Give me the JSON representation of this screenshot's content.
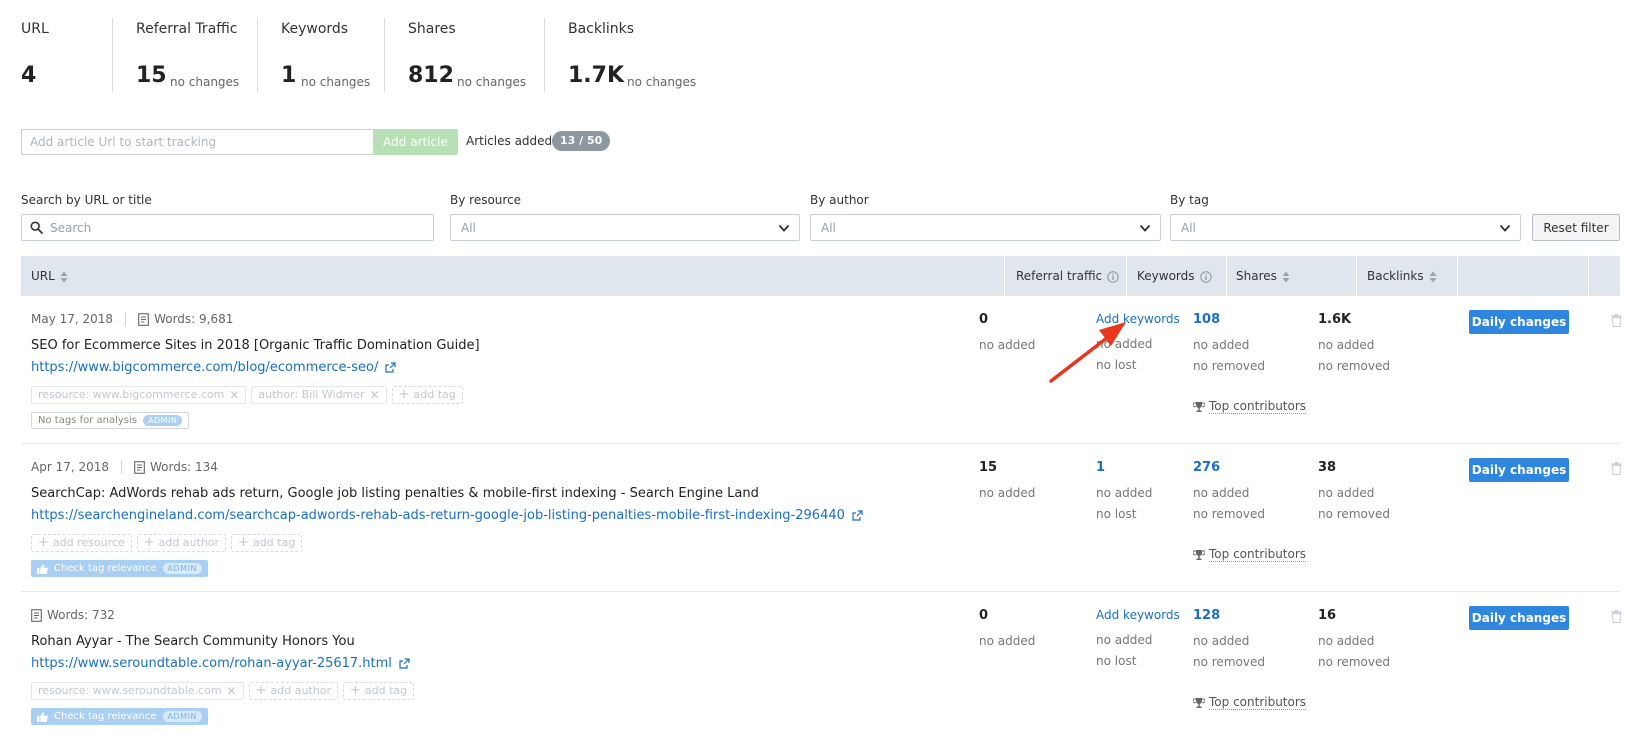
{
  "summary": [
    {
      "label": "URL",
      "value": "4",
      "change": ""
    },
    {
      "label": "Referral Traffic",
      "value": "15",
      "change": "no changes"
    },
    {
      "label": "Keywords",
      "value": "1",
      "change": "no changes"
    },
    {
      "label": "Shares",
      "value": "812",
      "change": "no changes"
    },
    {
      "label": "Backlinks",
      "value": "1.7K",
      "change": "no changes"
    }
  ],
  "add_article": {
    "placeholder": "Add article Url to start tracking",
    "button": "Add article",
    "added_label": "Articles added:",
    "added_count": "13 / 50"
  },
  "filters": {
    "search_label": "Search by URL or title",
    "search_placeholder": "Search",
    "resource_label": "By resource",
    "resource_value": "All",
    "author_label": "By author",
    "author_value": "All",
    "tag_label": "By tag",
    "tag_value": "All",
    "reset": "Reset filter"
  },
  "table": {
    "headers": {
      "url": "URL",
      "referral": "Referral traffic",
      "keywords": "Keywords",
      "shares": "Shares",
      "backlinks": "Backlinks"
    },
    "rows": [
      {
        "date": "May 17, 2018",
        "words": "Words: 9,681",
        "title": "SEO for Ecommerce Sites in 2018 [Organic Traffic Domination Guide]",
        "url": "https://www.bigcommerce.com/blog/ecommerce-seo/",
        "tag_resource": "resource: www.bigcommerce.com",
        "tag_author": "author: Bill Widmer",
        "tag_add": "add tag",
        "analysis": "No tags for analysis",
        "admin": "ADMIN",
        "referral": "0",
        "referral_sub": "no added",
        "keywords": "Add keywords",
        "keywords_sub1": "no added",
        "keywords_sub2": "no lost",
        "shares": "108",
        "shares_sub1": "no added",
        "shares_sub2": "no removed",
        "contributors": "Top contributors",
        "backlinks": "1.6K",
        "backlinks_sub1": "no added",
        "backlinks_sub2": "no removed",
        "daily": "Daily changes"
      },
      {
        "date": "Apr 17, 2018",
        "words": "Words: 134",
        "title": "SearchCap: AdWords rehab ads return, Google job listing penalties & mobile-first indexing - Search Engine Land",
        "url": "https://searchengineland.com/searchcap-adwords-rehab-ads-return-google-job-listing-penalties-mobile-first-indexing-296440",
        "tag_resource": "add resource",
        "tag_author": "add author",
        "tag_add": "add tag",
        "analysis": "Check tag relevance",
        "admin": "ADMIN",
        "referral": "15",
        "referral_sub": "no added",
        "keywords": "1",
        "keywords_sub1": "no added",
        "keywords_sub2": "no lost",
        "shares": "276",
        "shares_sub1": "no added",
        "shares_sub2": "no removed",
        "contributors": "Top contributors",
        "backlinks": "38",
        "backlinks_sub1": "no added",
        "backlinks_sub2": "no removed",
        "daily": "Daily changes"
      },
      {
        "date": "",
        "words": "Words: 732",
        "title": "Rohan Ayyar - The Search Community Honors You",
        "url": "https://www.seroundtable.com/rohan-ayyar-25617.html",
        "tag_resource": "resource: www.seroundtable.com",
        "tag_author": "add author",
        "tag_add": "add tag",
        "analysis": "Check tag relevance",
        "admin": "ADMIN",
        "referral": "0",
        "referral_sub": "no added",
        "keywords": "Add keywords",
        "keywords_sub1": "no added",
        "keywords_sub2": "no lost",
        "shares": "128",
        "shares_sub1": "no added",
        "shares_sub2": "no removed",
        "contributors": "Top contributors",
        "backlinks": "16",
        "backlinks_sub1": "no added",
        "backlinks_sub2": "no removed",
        "daily": "Daily changes"
      }
    ]
  },
  "colors": {
    "link": "#1a6fc4",
    "button_primary": "#2e86de",
    "header_bg": "#dfe6ee",
    "annotation_arrow": "#e8361f"
  }
}
